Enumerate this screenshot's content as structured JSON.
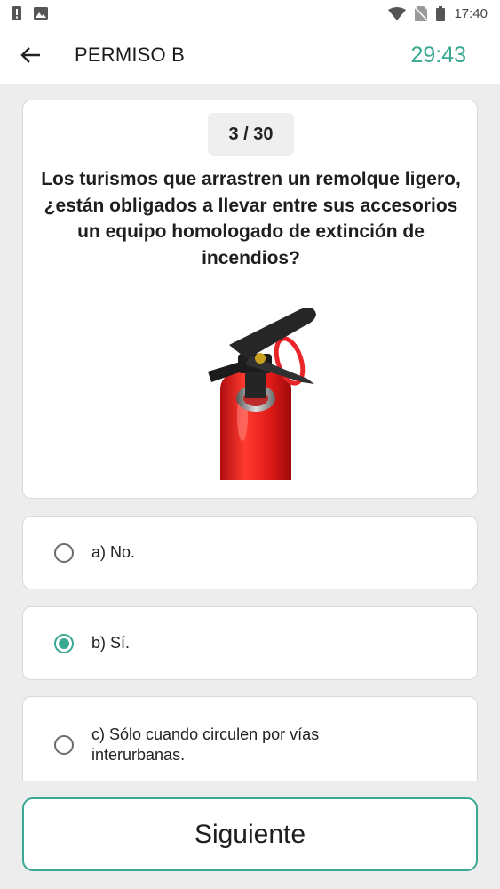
{
  "status_bar": {
    "time": "17:40",
    "icons": [
      "alert-icon",
      "image-icon",
      "wifi-icon",
      "no-sim-icon",
      "battery-icon"
    ]
  },
  "app_bar": {
    "back_icon": "arrow-left-icon",
    "title": "PERMISO B",
    "timer": "29:43"
  },
  "question": {
    "counter": "3 / 30",
    "text": "Los turismos que arrastren un remolque ligero, ¿están obligados a llevar entre sus accesorios un equipo homologado de extinción de incendios?",
    "image": "fire-extinguisher-image"
  },
  "answers": [
    {
      "label": "a) No.",
      "selected": false
    },
    {
      "label": "b) Sí.",
      "selected": true
    },
    {
      "label": "c) Sólo cuando circulen por vías interurbanas.",
      "selected": false
    }
  ],
  "footer": {
    "next_label": "Siguiente"
  },
  "colors": {
    "accent": "#3aa992",
    "background": "#ededed"
  }
}
